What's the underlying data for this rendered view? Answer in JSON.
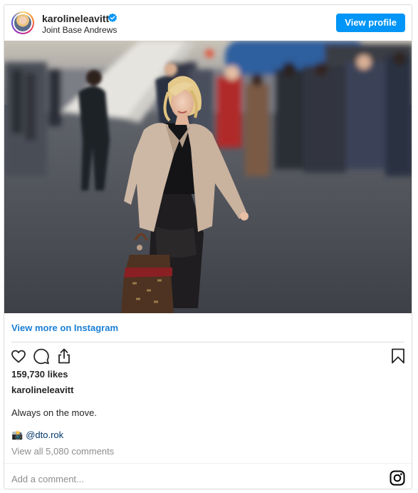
{
  "header": {
    "username": "karolineleavitt",
    "location": "Joint Base Andrews",
    "view_profile_label": "View profile"
  },
  "post": {
    "view_more_label": "View more on Instagram",
    "likes": "159,730 likes",
    "caption_username": "karolineleavitt",
    "caption_text": "Always on the move.",
    "credit_emoji": "📸",
    "credit_handle": "@dto.rok",
    "comments_link": "View all 5,080 comments",
    "comment_placeholder": "Add a comment..."
  },
  "icons": [
    "verified-badge-icon",
    "heart-icon",
    "comment-icon",
    "share-icon",
    "bookmark-icon",
    "instagram-icon",
    "camera-emoji-icon"
  ],
  "colors": {
    "accent": "#0095f6",
    "link": "#1a7fd6",
    "muted": "#8e8e8e",
    "border": "#dbdbdb"
  }
}
